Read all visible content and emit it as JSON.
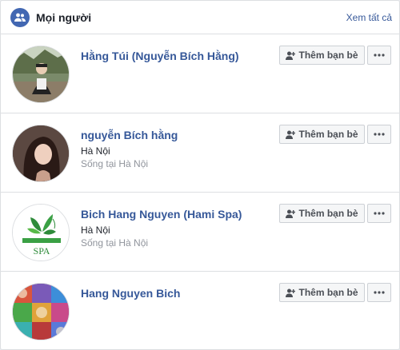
{
  "header": {
    "title": "Mọi người",
    "see_all": "Xem tất cả",
    "icon": "people-icon"
  },
  "people": [
    {
      "name": "Hằng Túi (Nguyễn Bích Hằng)",
      "location": "",
      "lives_in": "",
      "add_label": "Thêm bạn bè"
    },
    {
      "name": "nguyễn Bích hằng",
      "location": "Hà Nội",
      "lives_in": "Sống tại Hà Nội",
      "add_label": "Thêm bạn bè"
    },
    {
      "name": "Bich Hang Nguyen (Hami Spa)",
      "location": "Hà Nội",
      "lives_in": "Sống tại Hà Nội",
      "add_label": "Thêm bạn bè"
    },
    {
      "name": "Hang Nguyen Bich",
      "location": "",
      "lives_in": "",
      "add_label": "Thêm bạn bè"
    }
  ],
  "avatar3_logo_text": "SPA",
  "colors": {
    "link": "#365899",
    "brand": "#4267b2",
    "muted": "#90949c"
  }
}
